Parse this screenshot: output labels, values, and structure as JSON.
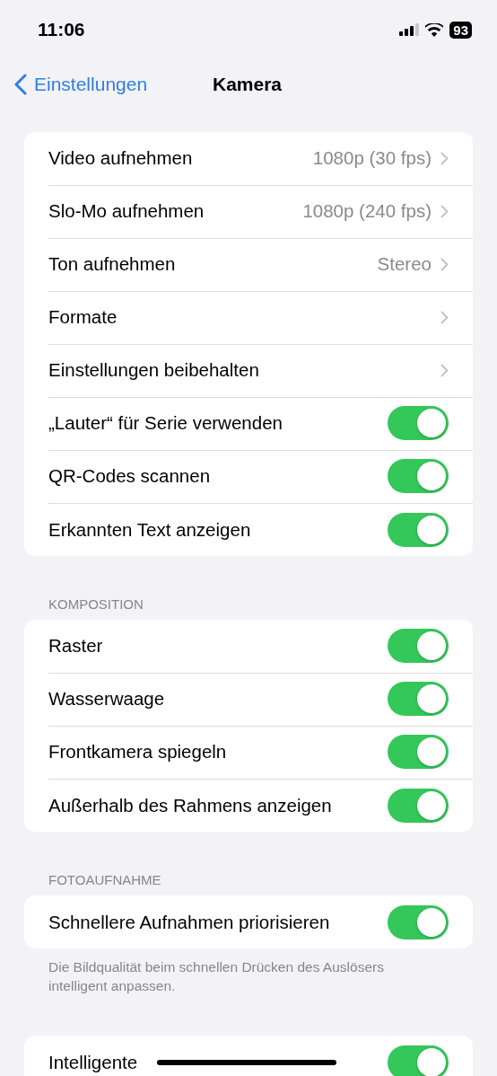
{
  "status_bar": {
    "time": "11:06",
    "battery": "93"
  },
  "nav": {
    "back": "Einstellungen",
    "title": "Kamera"
  },
  "groups": [
    {
      "rows": [
        {
          "kind": "link",
          "label": "Video aufnehmen",
          "value": "1080p (30 fps)"
        },
        {
          "kind": "link",
          "label": "Slo-Mo aufnehmen",
          "value": "1080p (240 fps)"
        },
        {
          "kind": "link",
          "label": "Ton aufnehmen",
          "value": "Stereo"
        },
        {
          "kind": "link",
          "label": "Formate"
        },
        {
          "kind": "link",
          "label": "Einstellungen beibehalten"
        },
        {
          "kind": "toggle",
          "label": "„Lauter“ für Serie verwenden",
          "on": true
        },
        {
          "kind": "toggle",
          "label": "QR-Codes scannen",
          "on": true
        },
        {
          "kind": "toggle",
          "label": "Erkannten Text anzeigen",
          "on": true
        }
      ]
    },
    {
      "header": "KOMPOSITION",
      "rows": [
        {
          "kind": "toggle",
          "label": "Raster",
          "on": true
        },
        {
          "kind": "toggle",
          "label": "Wasserwaage",
          "on": true
        },
        {
          "kind": "toggle",
          "label": "Frontkamera spiegeln",
          "on": true
        },
        {
          "kind": "toggle",
          "label": "Außerhalb des Rahmens anzeigen",
          "on": true
        }
      ]
    },
    {
      "header": "FOTOAUFNAHME",
      "rows": [
        {
          "kind": "toggle",
          "label": "Schnellere Aufnahmen priorisieren",
          "on": true
        }
      ],
      "footer": "Die Bildqualität beim schnellen Drücken des Auslösers intelligent anpassen."
    },
    {
      "rows": [
        {
          "kind": "toggle",
          "label": "Intelligente",
          "on": true
        }
      ]
    }
  ]
}
